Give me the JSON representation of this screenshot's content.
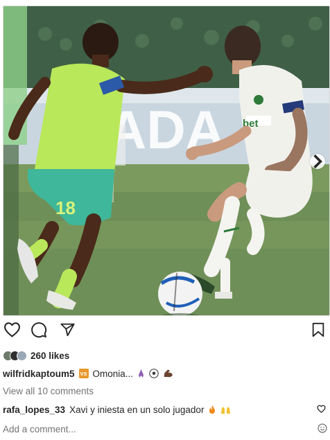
{
  "post": {
    "likes": "260 likes",
    "caption": {
      "username": "wilfridkaptoum5",
      "badge": "VS",
      "text": "Omonia..."
    },
    "view_comments": "View all 10 comments",
    "top_comment": {
      "username": "rafa_lopes_33",
      "text": "Xavi y iniesta en un solo jugador"
    },
    "add_comment_placeholder": "Add a comment...",
    "photo_text": {
      "player_number": "18",
      "ad_letters": "ADA",
      "sponsor": "bet"
    },
    "icons": {
      "like": "heart-icon",
      "comment": "comment-icon",
      "share": "paper-plane-icon",
      "save": "bookmark-icon",
      "carousel": "chevron-right-icon",
      "emoji": "smiley-icon"
    },
    "colors": {
      "pitch": "#6f8f58",
      "yellow_kit": "#b9e85a",
      "teal_shorts": "#3fb79a",
      "white_kit": "#f1f1ec",
      "green_trim": "#2e7a3a",
      "badge": "#e8982c"
    }
  }
}
